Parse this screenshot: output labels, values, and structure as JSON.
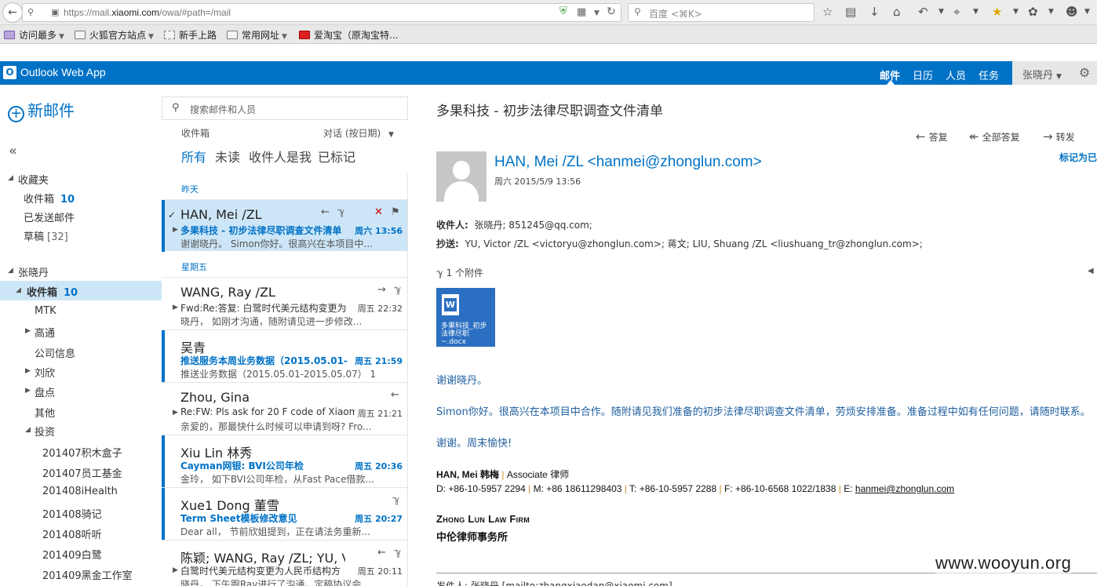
{
  "browser": {
    "url_prefix": "https://mail.",
    "url_domain": "xiaomi.com",
    "url_rest": "/owa/#path=/mail",
    "search_placeholder": "百度 <⌘K>",
    "bookmarks": [
      {
        "label": "访问最多",
        "dropdown": true
      },
      {
        "label": "火狐官方站点",
        "dropdown": true
      },
      {
        "label": "新手上路",
        "dropdown": false
      },
      {
        "label": "常用网址",
        "dropdown": true
      },
      {
        "label": "爱淘宝（原淘宝特...",
        "dropdown": false
      }
    ]
  },
  "owa": {
    "app_title": "Outlook Web App",
    "nav": [
      "邮件",
      "日历",
      "人员",
      "任务"
    ],
    "user": "张晓丹",
    "accent": "#0072c6"
  },
  "sidebar": {
    "new_mail": "新邮件",
    "favorites_label": "收藏夹",
    "favorites": [
      {
        "label": "收件箱",
        "count": "10"
      },
      {
        "label": "已发送邮件",
        "count": ""
      },
      {
        "label": "草稿",
        "count": "[32]"
      }
    ],
    "account_label": "张晓丹",
    "inbox": {
      "label": "收件箱",
      "count": "10"
    },
    "folders": [
      {
        "label": "MTK",
        "expander": false
      },
      {
        "label": "高通",
        "expander": true
      },
      {
        "label": "公司信息",
        "expander": false
      },
      {
        "label": "刘欣",
        "expander": true
      },
      {
        "label": "盘点",
        "expander": true
      },
      {
        "label": "其他",
        "expander": false
      },
      {
        "label": "投资",
        "expander": "open"
      }
    ],
    "subfolders": [
      "201407积木盒子",
      "201407员工基金",
      "201408iHealth",
      "201408骑记",
      "201408听听",
      "201409白鹭",
      "201409黑金工作室"
    ]
  },
  "list": {
    "search_placeholder": "搜索邮件和人员",
    "folder": "收件箱",
    "sort": "对话 (按日期)",
    "filters": [
      "所有",
      "未读",
      "收件人是我",
      "已标记"
    ],
    "group_yesterday": "昨天",
    "group_friday": "星期五",
    "messages": [
      {
        "sender": "HAN, Mei /ZL",
        "subject": "多果科技 - 初步法律尽职调查文件清单",
        "preview": "谢谢晓丹。 Simon你好。很高兴在本项目中...",
        "date": "周六 13:56"
      },
      {
        "sender": "WANG, Ray /ZL",
        "subject": "Fwd:Re:答复: 白鹭时代美元结构变更为",
        "preview": "晓丹， 如刚才沟通，随附请见进一步修改...",
        "date": "周五 22:32"
      },
      {
        "sender": "吴青",
        "subject": "推送服务本周业务数据（2015.05.01-",
        "preview": "推送业务数据（2015.05.01-2015.05.07） 1...",
        "date": "周五 21:59"
      },
      {
        "sender": "Zhou, Gina",
        "subject": "Re:FW: Pls ask for 20 F code of Xiaomi",
        "preview": "亲爱的，那最快什么时候可以申请到呀? Fro...",
        "date": "周五 21:21"
      },
      {
        "sender": "Xiu Lin 林秀",
        "subject": "Cayman网银: BVI公司年检",
        "preview": "金玲， 如下BVI公司年检，从Fast Pace借款...",
        "date": "周五 20:36"
      },
      {
        "sender": "Xue1 Dong 董雪",
        "subject": "Term Sheet模板修改意见",
        "preview": "Dear all， 节前欣姐提到，正在请法务重新...",
        "date": "周五 20:27"
      },
      {
        "sender": "陈颖; WANG, Ray /ZL; YU, V",
        "subject": "白鹭时代美元结构变更为人民币结构方",
        "preview": "晓丹， 下午跟Ray进行了沟通，定稿协议会...",
        "date": "周五 20:11"
      }
    ]
  },
  "reading": {
    "subject": "多果科技 - 初步法律尽职调查文件清单",
    "actions": [
      "答复",
      "全部答复",
      "转发"
    ],
    "from": "HAN, Mei /ZL <hanmei@zhonglun.com>",
    "date": "周六 2015/5/9 13:56",
    "mark": "标记为已",
    "to_label": "收件人:",
    "to": "张晓丹;  851245@qq.com;",
    "cc_label": "抄送:",
    "cc": "YU, Victor /ZL <victoryu@zhonglun.com>;  蒋文;  LIU, Shuang /ZL <liushuang_tr@zhonglun.com>;",
    "attach_count": "1 个附件",
    "attachment_name": "多果科技_初步法律尽职~.docx",
    "body": [
      "谢谢晓丹。",
      "Simon你好。很高兴在本项目中合作。随附请见我们准备的初步法律尽职调查文件清单，劳烦安排准备。准备过程中如有任何问题，请随时联系。",
      "谢谢。周末愉快!"
    ],
    "sig_name": "HAN, Mei 韩梅",
    "sig_title": "Associate 律师",
    "sig_d": "D: +86-10-5957 2294",
    "sig_m": "M: +86 18611298403",
    "sig_t": "T: +86-10-5957 2288",
    "sig_f": "F: +86-10-6568 1022/1838",
    "sig_e_label": "E:",
    "sig_email": "hanmei@zhonglun.com",
    "firm_en": "Zhong Lun Law Firm",
    "firm_cn": "中伦律师事务所",
    "quote_line": "发件人: 张晓丹 [mailto:zhangxiaodan@xiaomi.com]"
  },
  "watermark": "www.wooyun.org"
}
